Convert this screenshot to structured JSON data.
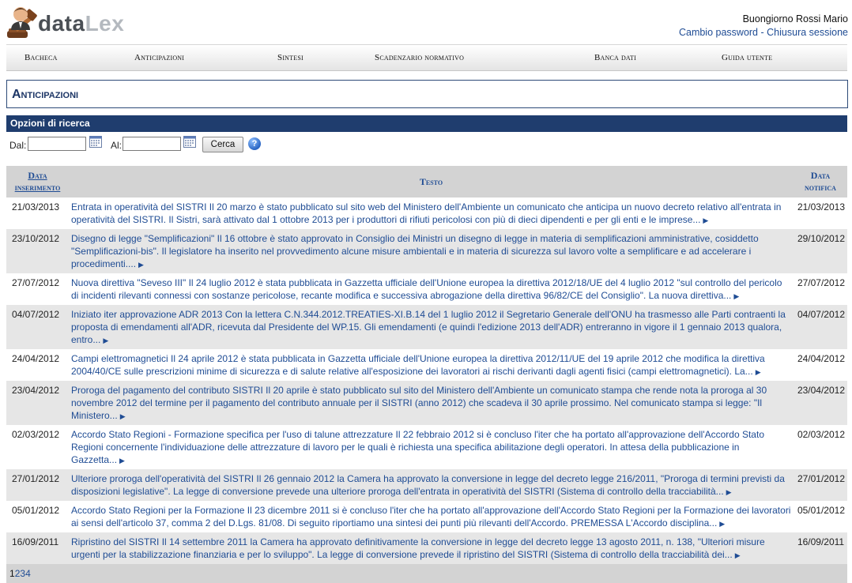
{
  "brand": {
    "part1": "data",
    "part2": "Lex"
  },
  "header": {
    "greeting": "Buongiorno Rossi Mario",
    "change_password": "Cambio password",
    "separator": "-",
    "logout": "Chiusura sessione"
  },
  "nav": [
    "Bacheca",
    "Anticipazioni",
    "Sintesi",
    "Scadenzario normativo",
    "Banca dati",
    "Guida utente"
  ],
  "page_title": "Anticipazioni",
  "search": {
    "section_title": "Opzioni di ricerca",
    "from_label": "Dal:",
    "to_label": "Al:",
    "from_value": "",
    "to_value": "",
    "button_label": "Cerca",
    "help_symbol": "?"
  },
  "table": {
    "col_insert_line1": "Data",
    "col_insert_line2": "inserimento",
    "col_text": "Testo",
    "col_notify_line1": "Data",
    "col_notify_line2": "notifica",
    "rows": [
      {
        "inserted": "21/03/2013",
        "text": "Entrata in operatività del SISTRI Il 20 marzo è stato pubblicato sul sito web del Ministero dell'Ambiente un comunicato che anticipa un nuovo decreto relativo all'entrata in operatività del SISTRI. Il Sistri, sarà attivato dal 1 ottobre 2013 per i produttori di rifiuti pericolosi con più di dieci dipendenti e per gli enti e le imprese...",
        "notified": "21/03/2013"
      },
      {
        "inserted": "23/10/2012",
        "text": "Disegno di legge \"Semplificazioni\" Il 16 ottobre è stato approvato in Consiglio dei Ministri un disegno di legge in materia di semplificazioni amministrative, cosiddetto \"Semplificazioni-bis\". Il legislatore ha inserito nel provvedimento alcune misure ambientali e in materia di sicurezza sul lavoro volte a semplificare e ad accelerare i procedimenti....",
        "notified": "29/10/2012"
      },
      {
        "inserted": "27/07/2012",
        "text": "Nuova direttiva \"Seveso III\" Il 24 luglio 2012 è stata pubblicata in Gazzetta ufficiale dell'Unione europea la direttiva 2012/18/UE del 4 luglio 2012 \"sul controllo del pericolo di incidenti rilevanti connessi con sostanze pericolose, recante modifica e successiva abrogazione della direttiva 96/82/CE del Consiglio\". La nuova direttiva...",
        "notified": "27/07/2012"
      },
      {
        "inserted": "04/07/2012",
        "text": "Iniziato iter approvazione ADR 2013 Con la lettera C.N.344.2012.TREATIES-XI.B.14 del 1 luglio 2012 il Segretario Generale dell'ONU ha trasmesso alle Parti contraenti la proposta di emendamenti all'ADR, ricevuta dal Presidente del WP.15. Gli emendamenti (e quindi l'edizione 2013 dell'ADR) entreranno in vigore il 1 gennaio 2013 qualora, entro...",
        "notified": "04/07/2012"
      },
      {
        "inserted": "24/04/2012",
        "text": "Campi elettromagnetici Il 24 aprile 2012 è stata pubblicata in Gazzetta ufficiale dell'Unione europea la direttiva 2012/11/UE del 19 aprile 2012 che modifica la direttiva 2004/40/CE sulle prescrizioni minime di sicurezza e di salute relative all'esposizione dei lavoratori ai rischi derivanti dagli agenti fisici (campi elettromagnetici). La...",
        "notified": "24/04/2012"
      },
      {
        "inserted": "23/04/2012",
        "text": "Proroga del pagamento del contributo SISTRI Il 20 aprile è stato pubblicato sul sito del Ministero dell'Ambiente un comunicato stampa che rende nota la proroga al 30 novembre 2012 del termine per il pagamento del contributo annuale per il SISTRI (anno 2012) che scadeva il 30 aprile prossimo. Nel comunicato stampa si legge: \"Il Ministero...",
        "notified": "23/04/2012"
      },
      {
        "inserted": "02/03/2012",
        "text": "Accordo Stato Regioni - Formazione specifica per l'uso di talune attrezzature Il 22 febbraio 2012 si è concluso l'iter che ha portato all'approvazione dell'Accordo Stato Regioni concernente l'individuazione delle attrezzature di lavoro per le quali è richiesta una specifica abilitazione degli operatori. In attesa della pubblicazione in Gazzetta...",
        "notified": "02/03/2012"
      },
      {
        "inserted": "27/01/2012",
        "text": "Ulteriore proroga dell'operatività del SISTRI Il 26 gennaio 2012 la Camera ha approvato la conversione in legge del decreto legge 216/2011, \"Proroga di termini previsti da disposizioni legislative\". La legge di conversione prevede una ulteriore proroga dell'entrata in operatività del SISTRI (Sistema di controllo della tracciabilità...",
        "notified": "27/01/2012"
      },
      {
        "inserted": "05/01/2012",
        "text": "Accordo Stato Regioni per la Formazione Il 23 dicembre 2011 si è concluso l'iter che ha portato all'approvazione dell'Accordo Stato Regioni per la Formazione dei lavoratori ai sensi dell'articolo 37, comma 2 del D.Lgs. 81/08. Di seguito riportiamo una sintesi dei punti più rilevanti dell'Accordo. PREMESSA L'Accordo disciplina...",
        "notified": "05/01/2012"
      },
      {
        "inserted": "16/09/2011",
        "text": "Ripristino del SISTRI Il 14 settembre 2011 la Camera ha approvato definitivamente la conversione in legge del decreto legge 13 agosto 2011, n. 138, \"Ulteriori misure urgenti per la stabilizzazione finanziaria e per lo sviluppo\". La legge di conversione prevede il ripristino del SISTRI (Sistema di controllo della tracciabilità dei...",
        "notified": "16/09/2011"
      }
    ]
  },
  "pager": {
    "current": "1",
    "pages": [
      "2",
      "3",
      "4"
    ]
  }
}
